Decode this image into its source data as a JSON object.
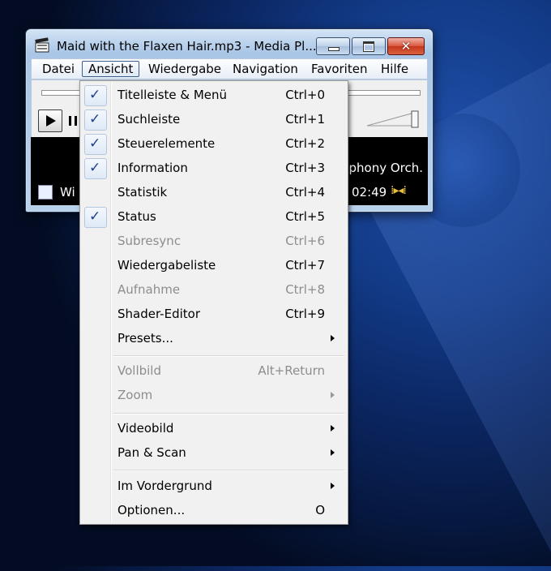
{
  "window": {
    "title": "Maid with the Flaxen Hair.mp3 - Media Pl...",
    "buttons": {
      "minimize": "minimize",
      "maximize": "maximize",
      "close": "✕"
    }
  },
  "menubar": {
    "items": [
      "Datei",
      "Ansicht",
      "Wiedergabe",
      "Navigation",
      "Favoriten",
      "Hilfe"
    ],
    "open_item": "Ansicht"
  },
  "player": {
    "info_text": "nphony Orch...",
    "status_left": "Wi",
    "time": "02:49",
    "volume_glyph": "⁞▸◂⁞"
  },
  "view_menu": {
    "items": [
      {
        "label": "Titelleiste & Menü",
        "shortcut": "Ctrl+0",
        "checked": true,
        "enabled": true
      },
      {
        "label": "Suchleiste",
        "shortcut": "Ctrl+1",
        "checked": true,
        "enabled": true
      },
      {
        "label": "Steuerelemente",
        "shortcut": "Ctrl+2",
        "checked": true,
        "enabled": true
      },
      {
        "label": "Information",
        "shortcut": "Ctrl+3",
        "checked": true,
        "enabled": true
      },
      {
        "label": "Statistik",
        "shortcut": "Ctrl+4",
        "checked": false,
        "enabled": true
      },
      {
        "label": "Status",
        "shortcut": "Ctrl+5",
        "checked": true,
        "enabled": true
      },
      {
        "label": "Subresync",
        "shortcut": "Ctrl+6",
        "checked": false,
        "enabled": false
      },
      {
        "label": "Wiedergabeliste",
        "shortcut": "Ctrl+7",
        "checked": false,
        "enabled": true
      },
      {
        "label": "Aufnahme",
        "shortcut": "Ctrl+8",
        "checked": false,
        "enabled": false
      },
      {
        "label": "Shader-Editor",
        "shortcut": "Ctrl+9",
        "checked": false,
        "enabled": true
      },
      {
        "label": "Presets...",
        "submenu": true,
        "enabled": true
      },
      {
        "label": "Vollbild",
        "shortcut": "Alt+Return",
        "enabled": false
      },
      {
        "label": "Zoom",
        "submenu": true,
        "enabled": false
      },
      {
        "label": "Videobild",
        "submenu": true,
        "enabled": true
      },
      {
        "label": "Pan & Scan",
        "submenu": true,
        "enabled": true
      },
      {
        "label": "Im Vordergrund",
        "submenu": true,
        "enabled": true
      },
      {
        "label": "Optionen...",
        "shortcut": "O",
        "enabled": true
      }
    ]
  },
  "colors": {
    "check_mark": "#1c3f8c",
    "disabled_text": "#8d8d8d",
    "menu_bg": "#f1f1f1"
  }
}
